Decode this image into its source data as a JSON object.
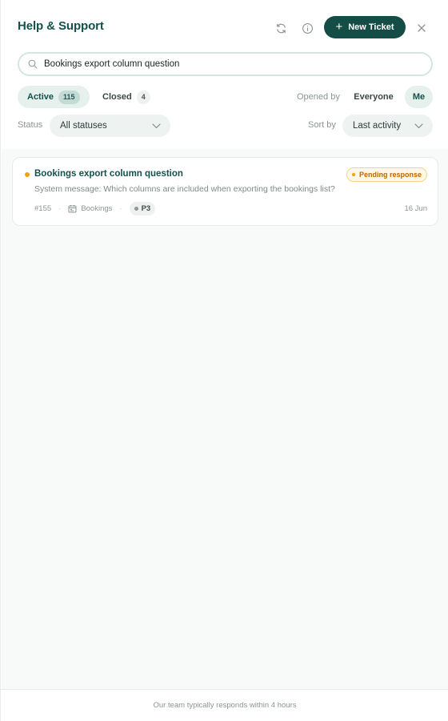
{
  "header": {
    "title": "Help & Support",
    "refresh_icon": "refresh-icon",
    "info_icon": "info-icon",
    "new_ticket_label": "New Ticket",
    "close_icon": "close-icon",
    "accent_color": "#134d46"
  },
  "search": {
    "value": "Bookings export column question",
    "placeholder": "Search tickets"
  },
  "tabs": [
    {
      "label": "Active",
      "count": "115",
      "selected": true
    },
    {
      "label": "Closed",
      "count": "4",
      "selected": false
    }
  ],
  "opened_by": {
    "label": "Opened by",
    "options": [
      {
        "label": "Everyone",
        "selected": false
      },
      {
        "label": "Me",
        "selected": true
      }
    ]
  },
  "filters": {
    "status_label": "Status",
    "status_value": "All statuses",
    "sort_label": "Sort by",
    "sort_value": "Last activity"
  },
  "tickets": [
    {
      "title": "Bookings export column question",
      "status": "Pending response",
      "status_color": "#b8680b",
      "preview": "System message: Which columns are included when exporting the bookings list?",
      "id": "#155",
      "category": "Bookings",
      "category_icon": "calendar-icon",
      "priority": "P3",
      "date": "16 Jun"
    }
  ],
  "footer": {
    "text": "Our team typically responds within 4 hours"
  }
}
